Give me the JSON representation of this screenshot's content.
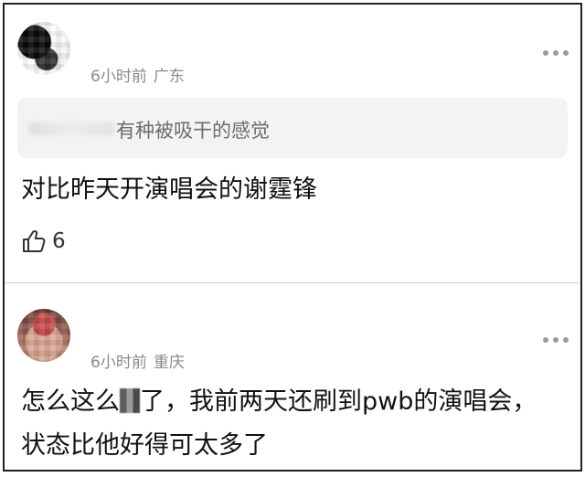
{
  "comments": [
    {
      "avatar_icon": "blurred-user-avatar",
      "time": "6小时前",
      "location": "广东",
      "quoted_reply": "有种被吸干的感觉",
      "text": "对比昨天开演唱会的谢霆锋",
      "like_icon": "thumbs-up-icon",
      "likes": "6",
      "more_icon": "more-dots-icon"
    },
    {
      "avatar_icon": "blurred-user-avatar",
      "time": "6小时前",
      "location": "重庆",
      "text_line1_before": "怎么这么",
      "text_line1_after": "了，我前两天还刷到pwb的演唱会，",
      "text_line2": "状态比他好得可太多了",
      "more_icon": "more-dots-icon"
    }
  ],
  "colors": {
    "meta": "#8a8a8a",
    "quote_background": "#f3f3f3",
    "quote_text": "#6c6c6c",
    "body_text": "#111111",
    "divider": "#d4d4d4"
  }
}
